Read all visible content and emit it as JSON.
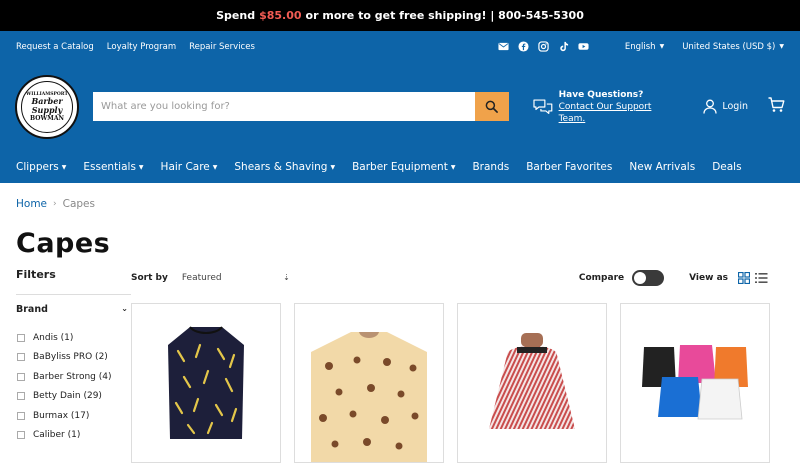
{
  "announce": {
    "prefix": "Spend",
    "price": "$85.00",
    "suffix": "or more to get free shipping! | 800-545-5300"
  },
  "utility": {
    "links": [
      "Request a Catalog",
      "Loyalty Program",
      "Repair Services"
    ],
    "social": [
      "email-icon",
      "facebook-icon",
      "instagram-icon",
      "tiktok-icon",
      "youtube-icon"
    ],
    "language": "English",
    "currency": "United States (USD $)"
  },
  "logo": {
    "top": "WILLIAMSPORT",
    "middle1": "Barber",
    "middle2": "Supply",
    "bottom": "BOWMAN"
  },
  "search": {
    "placeholder": "What are you looking for?"
  },
  "support": {
    "title": "Have Questions?",
    "link": "Contact Our Support Team."
  },
  "account": {
    "login": "Login"
  },
  "nav": {
    "items": [
      {
        "label": "Clippers",
        "dropdown": true
      },
      {
        "label": "Essentials",
        "dropdown": true
      },
      {
        "label": "Hair Care",
        "dropdown": true
      },
      {
        "label": "Shears & Shaving",
        "dropdown": true
      },
      {
        "label": "Barber Equipment",
        "dropdown": true
      },
      {
        "label": "Brands",
        "dropdown": false
      },
      {
        "label": "Barber Favorites",
        "dropdown": false
      },
      {
        "label": "New Arrivals",
        "dropdown": false
      },
      {
        "label": "Deals",
        "dropdown": false
      }
    ]
  },
  "breadcrumb": {
    "home": "Home",
    "current": "Capes"
  },
  "page": {
    "title": "Capes"
  },
  "filters": {
    "title": "Filters",
    "brand_title": "Brand",
    "brands": [
      "Andis (1)",
      "BaByliss PRO (2)",
      "Barber Strong (4)",
      "Betty Dain (29)",
      "Burmax (17)",
      "Caliber (1)"
    ]
  },
  "sort": {
    "label": "Sort by",
    "selected": "Featured",
    "compare": "Compare",
    "view_as": "View as"
  },
  "colors": {
    "brand_blue": "#0d64a8",
    "search_button": "#f0a24a",
    "price_red": "#f25c54"
  }
}
